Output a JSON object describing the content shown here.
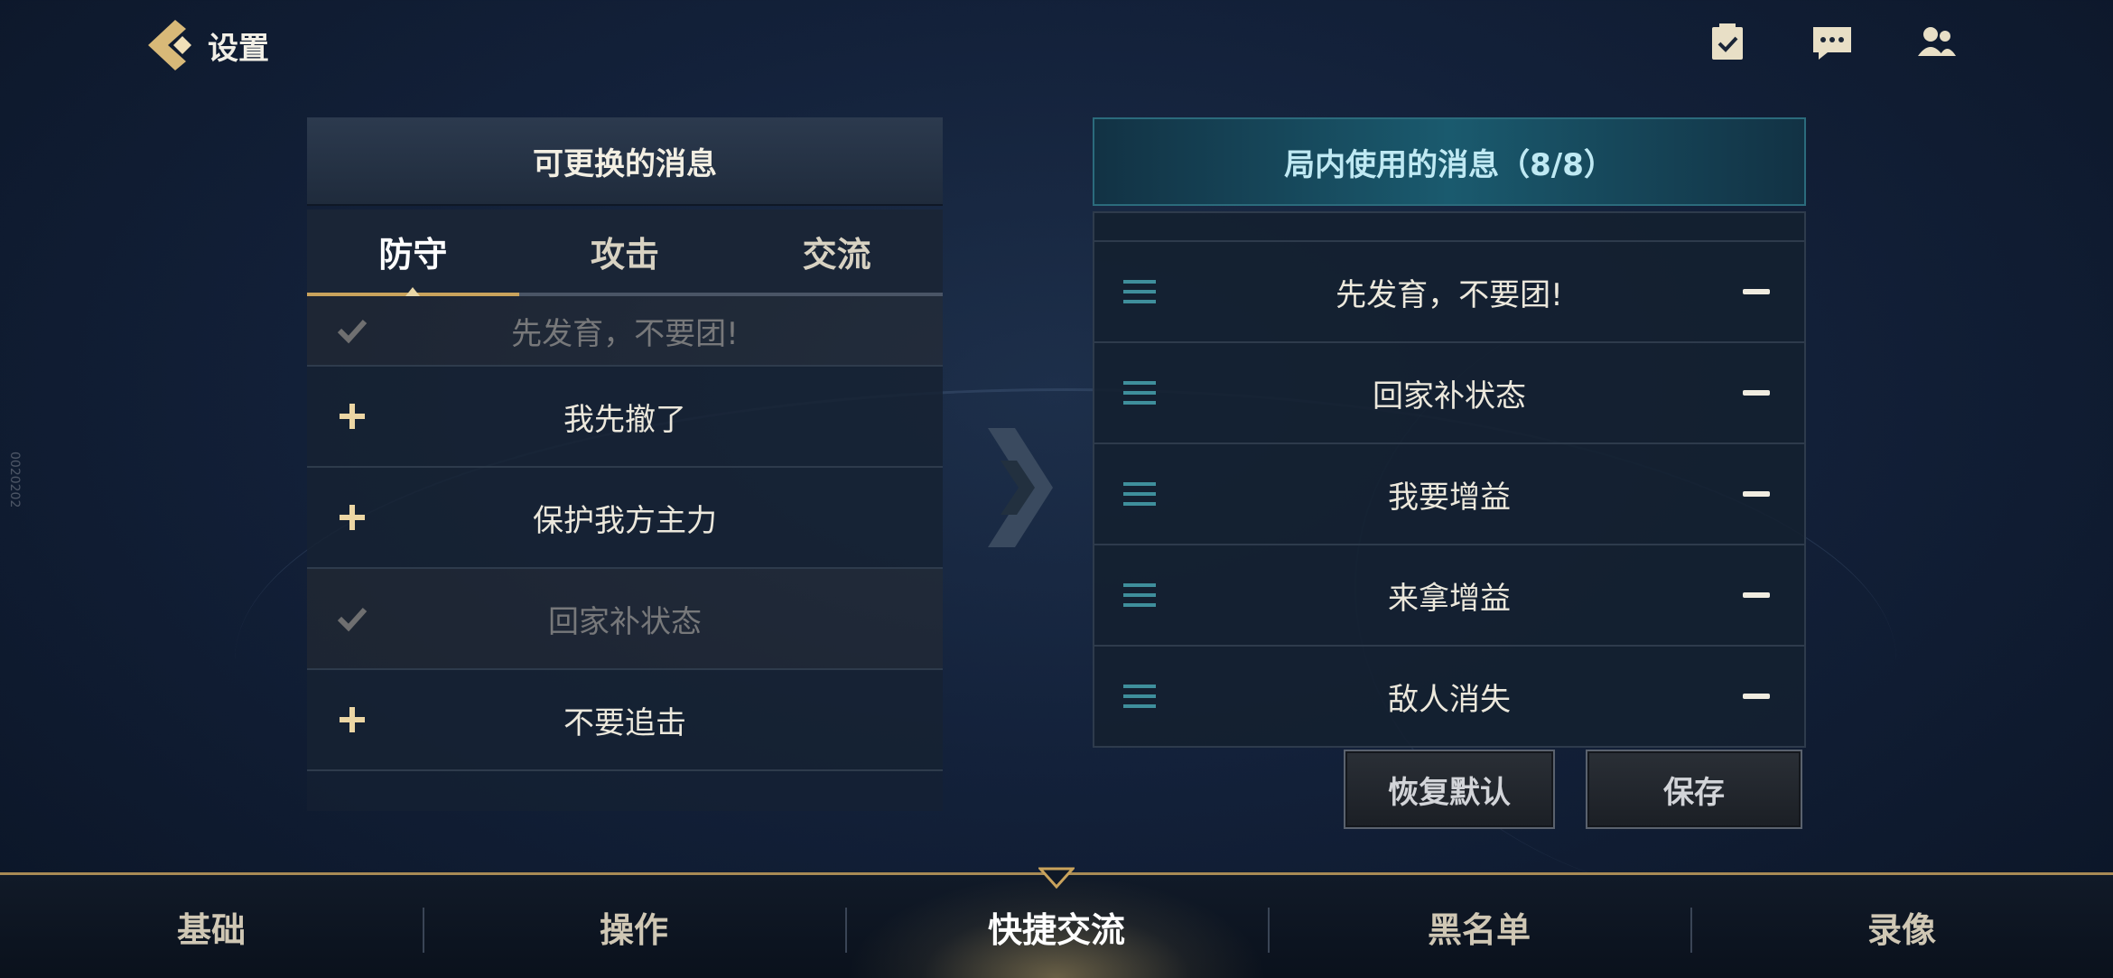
{
  "header": {
    "title": "设置"
  },
  "watermark": "0020202",
  "left_panel": {
    "title": "可更换的消息",
    "tabs": [
      {
        "label": "防守",
        "active": true
      },
      {
        "label": "攻击",
        "active": false
      },
      {
        "label": "交流",
        "active": false
      }
    ],
    "items": [
      {
        "text": "先发育，不要团!",
        "state": "selected"
      },
      {
        "text": "我先撤了",
        "state": "add"
      },
      {
        "text": "保护我方主力",
        "state": "add"
      },
      {
        "text": "回家补状态",
        "state": "selected"
      },
      {
        "text": "不要追击",
        "state": "add"
      }
    ]
  },
  "right_panel": {
    "title": "局内使用的消息（8/8）",
    "items": [
      {
        "text": "先发育，不要团!"
      },
      {
        "text": "回家补状态"
      },
      {
        "text": "我要增益"
      },
      {
        "text": "来拿增益"
      },
      {
        "text": "敌人消失"
      }
    ]
  },
  "buttons": {
    "restore": "恢复默认",
    "save": "保存"
  },
  "bottom_nav": {
    "items": [
      {
        "label": "基础",
        "active": false
      },
      {
        "label": "操作",
        "active": false
      },
      {
        "label": "快捷交流",
        "active": true
      },
      {
        "label": "黑名单",
        "active": false
      },
      {
        "label": "录像",
        "active": false
      }
    ]
  },
  "colors": {
    "accent_gold": "#c9a35c",
    "teal_header": "#1a5a6e"
  }
}
